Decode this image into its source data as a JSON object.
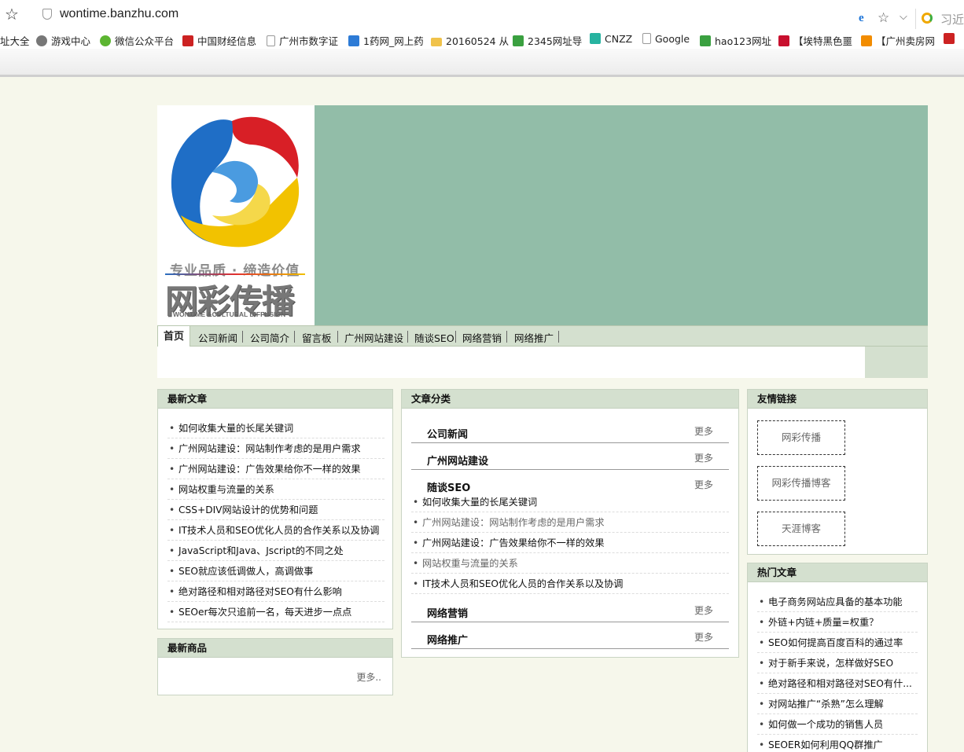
{
  "browser": {
    "url": "wontime.banzhu.com",
    "search_hint": "习近平会见",
    "bookmarks": [
      {
        "label": "址大全",
        "color": "#ffffff"
      },
      {
        "label": "游戏中心",
        "color": "#666666"
      },
      {
        "label": "微信公众平台",
        "color": "#5cb531"
      },
      {
        "label": "中国财经信息",
        "color": "#cc2222"
      },
      {
        "label": "广州市数字证",
        "color": "#ffffff"
      },
      {
        "label": "1药网_网上药",
        "color": "#2d7bd6"
      },
      {
        "label": "20160524 从",
        "color": "#f0c24a"
      },
      {
        "label": "2345网址导",
        "color": "#3aa040"
      },
      {
        "label": "CNZZ",
        "color": "#27b3a0"
      },
      {
        "label": "Google",
        "color": "#ffffff"
      },
      {
        "label": "hao123网址",
        "color": "#3aa040"
      },
      {
        "label": "【埃特黑色噩",
        "color": "#c8102e"
      },
      {
        "label": "【广州卖房网",
        "color": "#f28c00"
      }
    ]
  },
  "site": {
    "logo": {
      "slogan": "专业品质 · 缔造价值",
      "name_cn": "网彩传播",
      "name_en": "WONTIME &CULTURAL DIFFUSION"
    },
    "nav": [
      "首页",
      "公司新闻",
      "公司简介",
      "留言板",
      "广州网站建设",
      "随谈SEO",
      "网络营销",
      "网络推广"
    ],
    "latest_articles": {
      "title": "最新文章",
      "items": [
        "如何收集大量的长尾关键词",
        "广州网站建设：网站制作考虑的是用户需求",
        "广州网站建设：广告效果给你不一样的效果",
        "网站权重与流量的关系",
        "CSS+DIV网站设计的优势和问题",
        "IT技术人员和SEO优化人员的合作关系以及协调",
        "JavaScript和Java、Jscript的不同之处",
        "SEO就应该低调做人，高调做事",
        "绝对路径和相对路径对SEO有什么影响",
        "SEOer每次只追前一名，每天进步一点点"
      ]
    },
    "latest_products": {
      "title": "最新商品",
      "more": "更多.."
    },
    "categories": {
      "title": "文章分类",
      "more_label": "更多",
      "groups": [
        {
          "name": "公司新闻"
        },
        {
          "name": "广州网站建设"
        },
        {
          "name": "随谈SEO"
        },
        {
          "name": "网络营销"
        },
        {
          "name": "网络推广"
        }
      ],
      "seo_items": [
        "如何收集大量的长尾关键词",
        "广州网站建设：网站制作考虑的是用户需求",
        "广州网站建设：广告效果给你不一样的效果",
        "网站权重与流量的关系",
        "IT技术人员和SEO优化人员的合作关系以及协调"
      ]
    },
    "friend_links": {
      "title": "友情链接",
      "items": [
        "网彩传播",
        "网彩传播博客",
        "天涯博客"
      ]
    },
    "hot_articles": {
      "title": "热门文章",
      "items": [
        "电子商务网站应具备的基本功能",
        "外链+内链+质量=权重？",
        "SEO如何提高百度百科的通过率",
        "对于新手来说，怎样做好SEO",
        "绝对路径和相对路径对SEO有什...",
        "对网站推广“杀熟”怎么理解",
        "如何做一个成功的销售人员",
        "SEOER如何利用QQ群推广"
      ]
    }
  }
}
